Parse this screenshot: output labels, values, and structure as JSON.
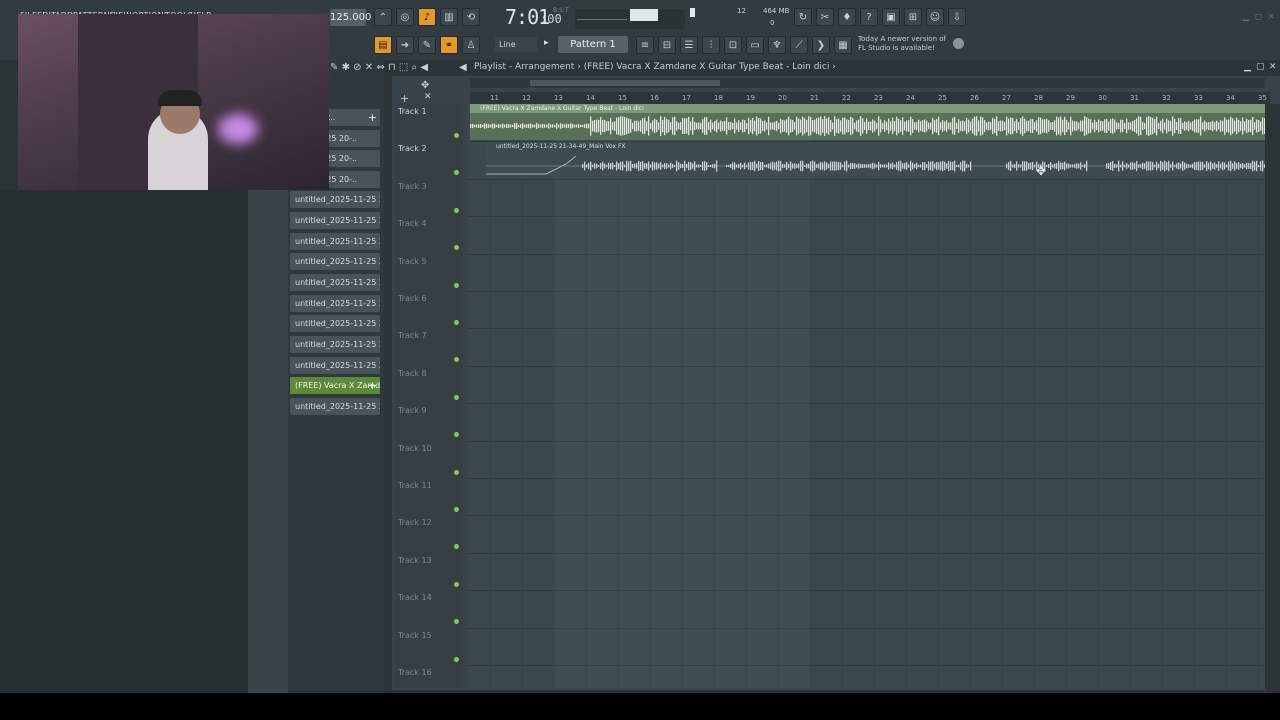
{
  "menu": [
    "FILE",
    "EDIT",
    "ADD",
    "PATTERNS",
    "VIEW",
    "OPTIONS",
    "TOOLS",
    "HELP"
  ],
  "transport": {
    "tempo": "125.000",
    "time": "7:01",
    "time_sub": ":00",
    "time_unit": "B:S:T",
    "cpu_voices": "12",
    "memory": "464 MB",
    "polyphony": "0"
  },
  "toolbar": {
    "snap": "Line",
    "pattern": "Pattern 1",
    "news_line1": "Today  A newer version of",
    "news_line2": "FL Studio is available!"
  },
  "playlist": {
    "title": "Playlist - Arrangement",
    "separator": "›",
    "project": "(FREE) Vacra X Zamdane X Guitar Type Beat - Loin dici",
    "trailing": "›"
  },
  "ruler": [
    "11",
    "12",
    "13",
    "14",
    "15",
    "16",
    "17",
    "18",
    "19",
    "20",
    "21",
    "22",
    "23",
    "24",
    "25",
    "26",
    "27",
    "28",
    "29",
    "30",
    "31",
    "32",
    "33",
    "34",
    "35"
  ],
  "tracks": [
    "Track 1",
    "Track 2",
    "Track 3",
    "Track 4",
    "Track 5",
    "Track 6",
    "Track 7",
    "Track 8",
    "Track 9",
    "Track 10",
    "Track 11",
    "Track 12",
    "Track 13",
    "Track 14",
    "Track 15",
    "Track 16"
  ],
  "clips": {
    "clip1": "(FREE) Vacra X Zamdane X Guitar Type Beat - Loin dici",
    "clip2": "untitled_2025-11-25 21-34-49_Main Vox FX"
  },
  "browser": [
    "ype beat..",
    "025-11-25 20-..",
    "025-11-25 20-..",
    "025-11-25 20-..",
    "untitled_2025-11-25 20-..",
    "untitled_2025-11-25 20-..",
    "untitled_2025-11-25 20-..",
    "untitled_2025-11-25 20-..",
    "untitled_2025-11-25 20-..",
    "untitled_2025-11-25 20-..",
    "untitled_2025-11-25 20-..",
    "untitled_2025-11-25 20-..",
    "untitled_2025-11-25 20-..",
    "untitled_2025-11-25 20-..",
    "(FREE) Vacra X Zamd..",
    "untitled_2025-11-25 21-.."
  ]
}
